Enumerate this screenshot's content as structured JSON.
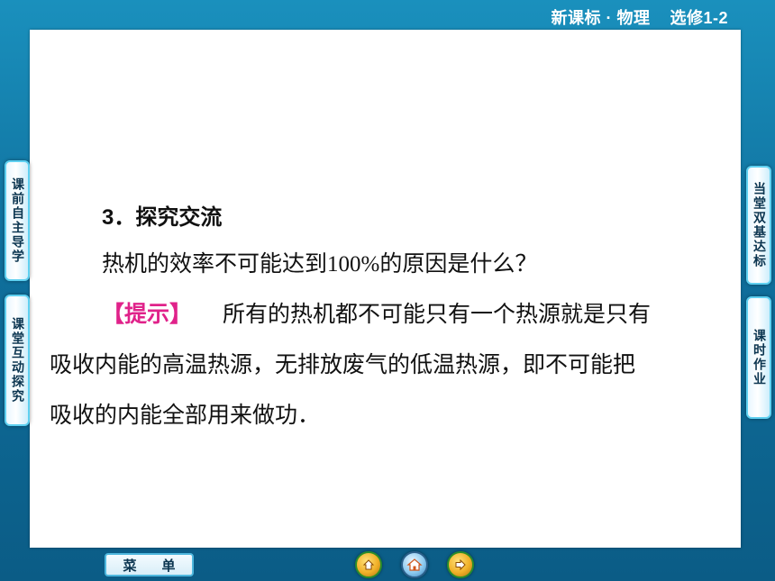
{
  "header": {
    "title_main": "新课标 · 物理",
    "title_sub": "选修1-2"
  },
  "content": {
    "heading": "3．探究交流",
    "question": "热机的效率不可能达到100%的原因是什么？",
    "hint_label": "【提示】",
    "hint_text": "所有的热机都不可能只有一个热源就是只有",
    "body_line_1": "吸收内能的高温热源，无排放废气的低温热源，即不可能把",
    "body_line_2": "吸收的内能全部用来做功．"
  },
  "left_tabs": [
    {
      "label": "课前自主导学"
    },
    {
      "label": "课堂互动探究"
    }
  ],
  "right_tabs": [
    {
      "label": "当堂双基达标"
    },
    {
      "label": "课时作业"
    }
  ],
  "footer": {
    "menu_label": "菜单",
    "nav_icons": [
      "previous-icon",
      "home-icon",
      "next-icon"
    ]
  },
  "colors": {
    "background": "#0f6f9c",
    "hint_accent": "#e0228a",
    "tab_border": "#5fd0f0"
  }
}
